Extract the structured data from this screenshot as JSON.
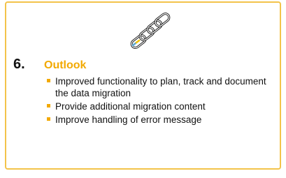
{
  "section": {
    "number": "6.",
    "title": "Outlook"
  },
  "illustration": {
    "icon": "chain-link-icon",
    "accent_colors": [
      "#5aa9d6",
      "#f2c200",
      "#111111"
    ]
  },
  "items": [
    {
      "text": "Improved functionality to plan, track and document the data migration"
    },
    {
      "text": "Provide additional migration content"
    },
    {
      "text": "Improve handling of error message"
    }
  ],
  "colors": {
    "border": "#f3c34a",
    "accent": "#f2a900",
    "text": "#111111"
  }
}
